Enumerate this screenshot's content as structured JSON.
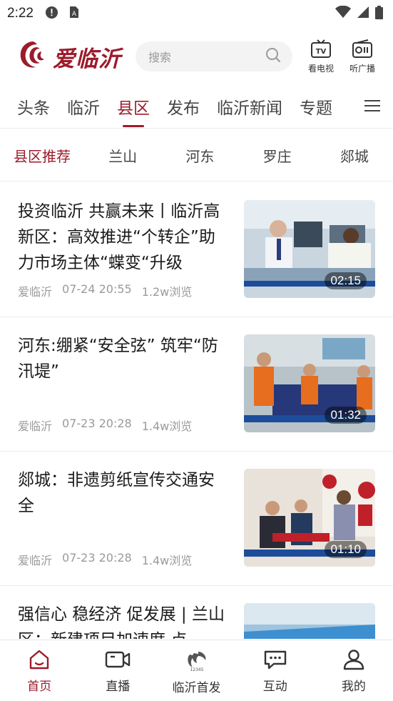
{
  "status_bar": {
    "time": "2:22"
  },
  "header": {
    "logo_text": "爱临沂",
    "search_placeholder": "搜索",
    "actions": [
      {
        "label": "看电视",
        "icon": "tv-icon"
      },
      {
        "label": "听广播",
        "icon": "radio-icon"
      }
    ]
  },
  "channels": {
    "items": [
      "头条",
      "临沂",
      "县区",
      "发布",
      "临沂新闻",
      "专题"
    ],
    "active": "县区"
  },
  "sub_channels": {
    "items": [
      "县区推荐",
      "兰山",
      "河东",
      "罗庄",
      "郯城"
    ],
    "active": "县区推荐"
  },
  "news": [
    {
      "title": "投资临沂 共赢未来丨临沂高新区：高效推进“个转企”助力市场主体“蝶变“升级",
      "source": "爱临沂",
      "time": "07-24 20:55",
      "views": "1.2w浏览",
      "duration": "02:15"
    },
    {
      "title": "河东:绷紧“安全弦” 筑牢“防汛堤”",
      "source": "爱临沂",
      "time": "07-23 20:28",
      "views": "1.4w浏览",
      "duration": "01:32"
    },
    {
      "title": "郯城：非遗剪纸宣传交通安全",
      "source": "爱临沂",
      "time": "07-23 20:28",
      "views": "1.4w浏览",
      "duration": "01:10"
    },
    {
      "title": "强信心 稳经济 促发展 | 兰山区：新建项目加速度 点",
      "source": "",
      "time": "",
      "views": "",
      "duration": ""
    }
  ],
  "bottom_nav": {
    "items": [
      {
        "label": "首页",
        "icon": "home-icon"
      },
      {
        "label": "直播",
        "icon": "live-camera-icon"
      },
      {
        "label": "临沂首发",
        "icon": "linyi-first-icon"
      },
      {
        "label": "互动",
        "icon": "chat-icon"
      },
      {
        "label": "我的",
        "icon": "user-icon"
      }
    ],
    "active": "首页"
  },
  "colors": {
    "brand": "#9c1b2c",
    "text": "#1a1a1a",
    "meta": "#9a9a9a"
  }
}
